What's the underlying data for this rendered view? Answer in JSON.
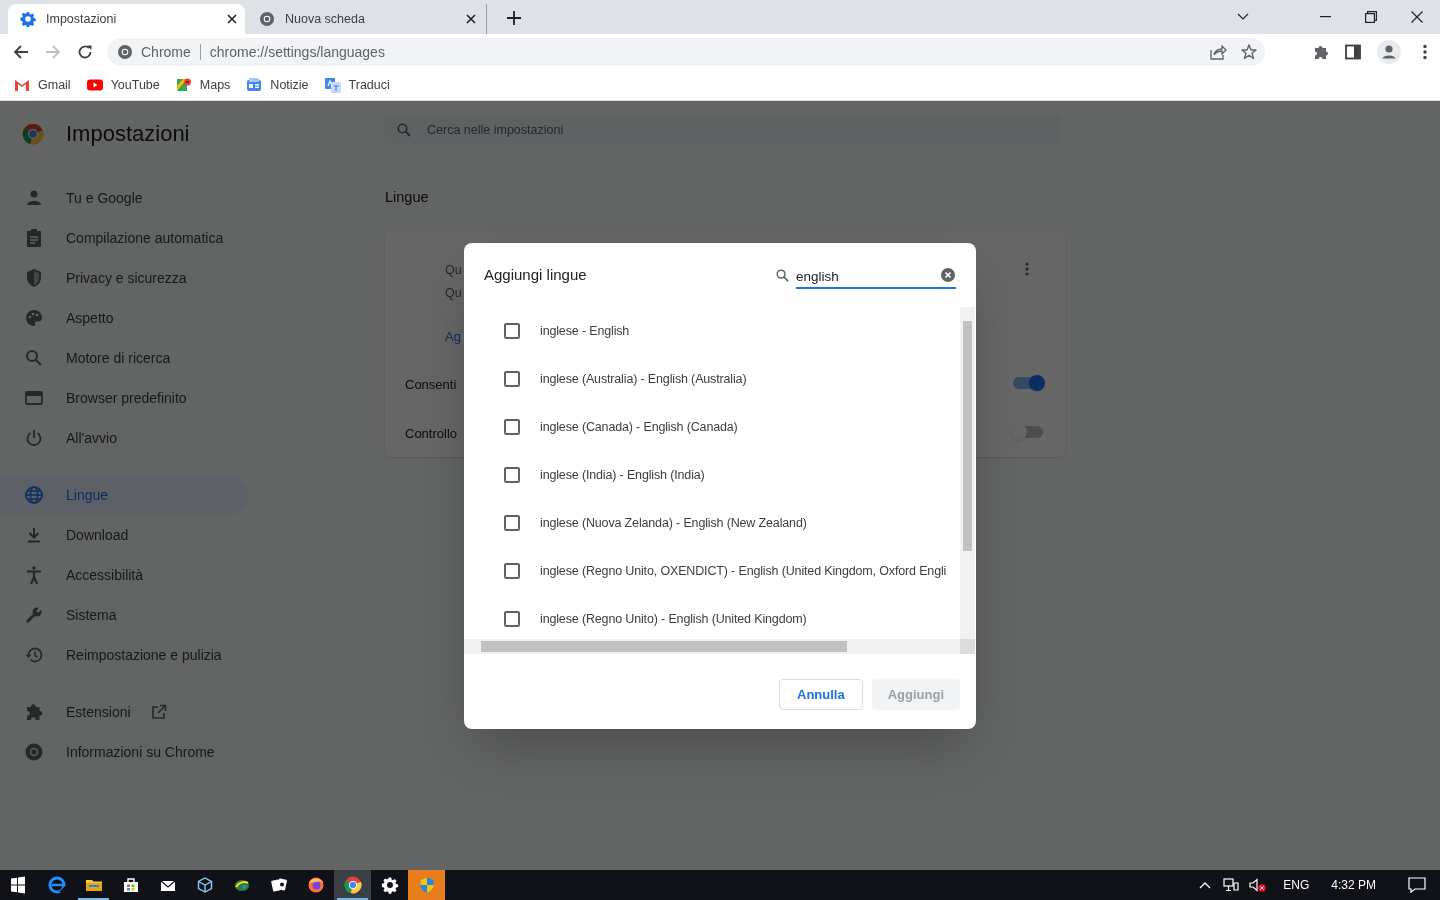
{
  "tabs": [
    {
      "title": "Impostazioni",
      "selected": true
    },
    {
      "title": "Nuova scheda",
      "selected": false
    }
  ],
  "address_bar": {
    "site_label": "Chrome",
    "url": "chrome://settings/languages"
  },
  "bookmarks": [
    "Gmail",
    "YouTube",
    "Maps",
    "Notizie",
    "Traduci"
  ],
  "settings": {
    "title": "Impostazioni",
    "search": {
      "placeholder": "Cerca nelle impostazioni"
    },
    "sidebar": {
      "sections": [
        [
          {
            "label": "Tu e Google",
            "selected": false
          },
          {
            "label": "Compilazione automatica",
            "selected": false
          },
          {
            "label": "Privacy e sicurezza",
            "selected": false
          },
          {
            "label": "Aspetto",
            "selected": false
          },
          {
            "label": "Motore di ricerca",
            "selected": false
          },
          {
            "label": "Browser predefinito",
            "selected": false
          },
          {
            "label": "All'avvio",
            "selected": false
          }
        ],
        [
          {
            "label": "Lingue",
            "selected": true
          },
          {
            "label": "Download",
            "selected": false
          },
          {
            "label": "Accessibilità",
            "selected": false
          },
          {
            "label": "Sistema",
            "selected": false
          },
          {
            "label": "Reimpostazione e pulizia",
            "selected": false
          }
        ],
        [
          {
            "label": "Estensioni",
            "selected": false
          },
          {
            "label": "Informazioni su Chrome",
            "selected": false
          }
        ]
      ]
    },
    "section_title": "Lingue",
    "card": {
      "lines": [
        "Qu",
        "Qu"
      ],
      "link": "Ag",
      "toggles": [
        {
          "label": "Consenti",
          "on": true
        },
        {
          "label": "Controllo",
          "on": false
        }
      ]
    }
  },
  "dialog": {
    "title": "Aggiungi lingue",
    "search": {
      "value": "english"
    },
    "languages": [
      {
        "label": "inglese - English",
        "checked": false
      },
      {
        "label": "inglese (Australia) - English (Australia)",
        "checked": false
      },
      {
        "label": "inglese (Canada) - English (Canada)",
        "checked": false
      },
      {
        "label": "inglese (India) - English (India)",
        "checked": false
      },
      {
        "label": "inglese (Nuova Zelanda) - English (New Zealand)",
        "checked": false
      },
      {
        "label": "inglese (Regno Unito, OXENDICT) - English (United Kingdom, Oxford Engli",
        "checked": false
      },
      {
        "label": "inglese (Regno Unito) - English (United Kingdom)",
        "checked": false
      }
    ],
    "buttons": [
      {
        "label": "Annulla",
        "disabled": false
      },
      {
        "label": "Aggiungi",
        "disabled": true
      }
    ]
  },
  "taskbar": {
    "apps": [
      {
        "open": false,
        "selected": false,
        "attention": false
      },
      {
        "open": true,
        "selected": false,
        "attention": false
      },
      {
        "open": false,
        "selected": false,
        "attention": false
      },
      {
        "open": false,
        "selected": false,
        "attention": false
      },
      {
        "open": false,
        "selected": false,
        "attention": false
      },
      {
        "open": false,
        "selected": false,
        "attention": false
      },
      {
        "open": false,
        "selected": false,
        "attention": false
      },
      {
        "open": false,
        "selected": false,
        "attention": false
      },
      {
        "open": true,
        "selected": true,
        "attention": false
      },
      {
        "open": false,
        "selected": false,
        "attention": false
      },
      {
        "open": false,
        "selected": false,
        "attention": true
      }
    ],
    "language": "ENG",
    "time": "4:32 PM"
  }
}
